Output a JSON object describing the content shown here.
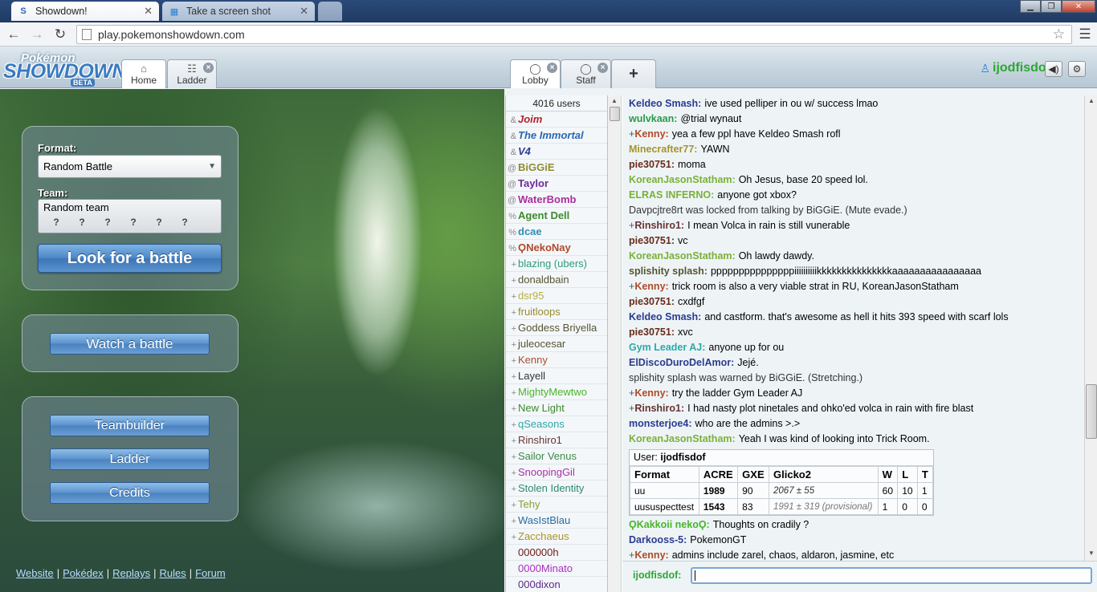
{
  "browser": {
    "tabs": [
      {
        "title": "Showdown!",
        "active": true
      },
      {
        "title": "Take a screen shot",
        "active": false
      }
    ],
    "url": "play.pokemonshowdown.com"
  },
  "header": {
    "logo": {
      "line1": "Pokémon",
      "line2": "SHOWDOWN",
      "badge": "BETA"
    },
    "left_tabs": [
      {
        "label": "Home",
        "icon": "home-icon"
      },
      {
        "label": "Ladder",
        "icon": "list-icon"
      }
    ],
    "room_tabs": [
      {
        "label": "Lobby",
        "icon": "chat-bubble-icon"
      },
      {
        "label": "Staff",
        "icon": "chat-bubble-icon"
      }
    ],
    "add_tab": "+",
    "username": "ijodfisdof"
  },
  "home": {
    "format_label": "Format:",
    "format_value": "Random Battle",
    "team_label": "Team:",
    "team_value": "Random team",
    "look_button": "Look for a battle",
    "watch_button": "Watch a battle",
    "teambuilder_button": "Teambuilder",
    "ladder_button": "Ladder",
    "credits_button": "Credits",
    "links": [
      "Website",
      "Pokédex",
      "Replays",
      "Rules",
      "Forum"
    ]
  },
  "userlist": {
    "count": "4016 users",
    "users": [
      {
        "group": "&",
        "name": "Joim",
        "color": "#b3232a",
        "style": "bi"
      },
      {
        "group": "&",
        "name": "The Immortal",
        "color": "#2a67b0",
        "style": "bi"
      },
      {
        "group": "&",
        "name": "V4",
        "color": "#2b3b8f",
        "style": "bi"
      },
      {
        "group": "@",
        "name": "BiGGiE",
        "color": "#8d8d30",
        "style": "b"
      },
      {
        "group": "@",
        "name": "Taylor",
        "color": "#6a2b9a",
        "style": "b"
      },
      {
        "group": "@",
        "name": "WaterBomb",
        "color": "#a8309b",
        "style": "b"
      },
      {
        "group": "%",
        "name": "Agent Dell",
        "color": "#3c8c2c",
        "style": "b"
      },
      {
        "group": "%",
        "name": "dcae",
        "color": "#2e8fb5",
        "style": "b"
      },
      {
        "group": "%",
        "name": "ϘNekoNay",
        "color": "#b04a2a",
        "style": "b"
      },
      {
        "group": "+",
        "name": "blazing (ubers)",
        "color": "#2e9a7a",
        "style": ""
      },
      {
        "group": "+",
        "name": "donaldbain",
        "color": "#555533",
        "style": ""
      },
      {
        "group": "+",
        "name": "dsr95",
        "color": "#b3b044",
        "style": ""
      },
      {
        "group": "+",
        "name": "fruitloops",
        "color": "#9a8a30",
        "style": ""
      },
      {
        "group": "+",
        "name": "Goddess Briyella",
        "color": "#555533",
        "style": ""
      },
      {
        "group": "+",
        "name": "juleocesar",
        "color": "#555533",
        "style": ""
      },
      {
        "group": "+",
        "name": "Kenny",
        "color": "#b04a2a",
        "style": ""
      },
      {
        "group": "+",
        "name": "Layell",
        "color": "#333333",
        "style": ""
      },
      {
        "group": "+",
        "name": "MightyMewtwo",
        "color": "#49b52c",
        "style": ""
      },
      {
        "group": "+",
        "name": "New Light",
        "color": "#3a8a30",
        "style": ""
      },
      {
        "group": "+",
        "name": "qSeasons",
        "color": "#2ea8a8",
        "style": ""
      },
      {
        "group": "+",
        "name": "Rinshiro1",
        "color": "#663333",
        "style": ""
      },
      {
        "group": "+",
        "name": "Sailor Venus",
        "color": "#3a8a4a",
        "style": ""
      },
      {
        "group": "+",
        "name": "SnoopingGil",
        "color": "#a830a8",
        "style": ""
      },
      {
        "group": "+",
        "name": "Stolen Identity",
        "color": "#2e8a6a",
        "style": ""
      },
      {
        "group": "+",
        "name": "Tehy",
        "color": "#88a030",
        "style": ""
      },
      {
        "group": "+",
        "name": "WasIstBlau",
        "color": "#2a6aa0",
        "style": ""
      },
      {
        "group": "+",
        "name": "Zacchaeus",
        "color": "#a8942a",
        "style": ""
      },
      {
        "group": "",
        "name": "000000h",
        "color": "#6a1a1a",
        "style": ""
      },
      {
        "group": "",
        "name": "0000Minato",
        "color": "#a830c0",
        "style": ""
      },
      {
        "group": "",
        "name": "000dixon",
        "color": "#5a2a8a",
        "style": ""
      }
    ]
  },
  "chat": {
    "messages": [
      {
        "rank": "",
        "author": "Keldeo Smash:",
        "color": "#2b3b8f",
        "text": "ive used pelliper in ou w/ success lmao"
      },
      {
        "rank": "",
        "author": "wulvkaan:",
        "color": "#2a9a4a",
        "text": "@trial wynaut"
      },
      {
        "rank": "+",
        "author": "Kenny:",
        "color": "#b04a2a",
        "text": "yea a few ppl have Keldeo Smash rofl"
      },
      {
        "rank": "",
        "author": "Minecrafter77:",
        "color": "#a8942a",
        "text": "YAWN"
      },
      {
        "rank": "",
        "author": "pie30751:",
        "color": "#6a2a1a",
        "text": "moma"
      },
      {
        "rank": "",
        "author": "KoreanJasonStatham:",
        "color": "#7ab03a",
        "text": "Oh Jesus, base 20 speed lol."
      },
      {
        "rank": "",
        "author": "ELRAS INFERNO:",
        "color": "#7ab03a",
        "text": "anyone got xbox?"
      },
      {
        "rank": "",
        "author": "",
        "color": "#333333",
        "text": "Davpcjtre8rt was locked from talking by BiGGiE. (Mute evade.)"
      },
      {
        "rank": "+",
        "author": "Rinshiro1:",
        "color": "#663333",
        "text": "I mean Volca in rain is still vunerable"
      },
      {
        "rank": "",
        "author": "pie30751:",
        "color": "#6a2a1a",
        "text": "vc"
      },
      {
        "rank": "",
        "author": "KoreanJasonStatham:",
        "color": "#7ab03a",
        "text": "Oh lawdy dawdy."
      },
      {
        "rank": "",
        "author": "splishity splash:",
        "color": "#555533",
        "text": "pppppppppppppppiiiiiiiiiikkkkkkkkkkkkkkkaaaaaaaaaaaaaaaa"
      },
      {
        "rank": "+",
        "author": "Kenny:",
        "color": "#b04a2a",
        "text": "trick room is also a very viable strat in RU, KoreanJasonStatham"
      },
      {
        "rank": "",
        "author": "pie30751:",
        "color": "#6a2a1a",
        "text": "cxdfgf"
      },
      {
        "rank": "",
        "author": "Keldeo Smash:",
        "color": "#2b3b8f",
        "text": "and castform. that's awesome as hell it hits 393 speed with scarf lols"
      },
      {
        "rank": "",
        "author": "pie30751:",
        "color": "#6a2a1a",
        "text": "xvc"
      },
      {
        "rank": "",
        "author": "Gym Leader AJ:",
        "color": "#2ea8a8",
        "text": "anyone up for ou"
      },
      {
        "rank": "",
        "author": "ElDiscoDuroDelAmor:",
        "color": "#2b3b8f",
        "text": "Jejé."
      },
      {
        "rank": "",
        "author": "",
        "color": "#333333",
        "text": "splishity splash was warned by BiGGiE. (Stretching.)"
      },
      {
        "rank": "+",
        "author": "Kenny:",
        "color": "#b04a2a",
        "text": "try the ladder Gym Leader AJ"
      },
      {
        "rank": "+",
        "author": "Rinshiro1:",
        "color": "#663333",
        "text": "I had nasty plot ninetales and ohko'ed volca in rain with fire blast"
      },
      {
        "rank": "",
        "author": "monsterjoe4:",
        "color": "#2b3b8f",
        "text": "who are the admins >.>"
      },
      {
        "rank": "",
        "author": "KoreanJasonStatham:",
        "color": "#7ab03a",
        "text": "Yeah I was kind of looking into Trick Room."
      }
    ],
    "rating": {
      "user_label": "User:",
      "user": "ijodfisdof",
      "columns": [
        "Format",
        "ACRE",
        "GXE",
        "Glicko2",
        "W",
        "L",
        "T"
      ],
      "rows": [
        {
          "format": "uu",
          "acre": "1989",
          "gxe": "90",
          "glicko": "2067 ± 55",
          "w": "60",
          "l": "10",
          "t": "1"
        },
        {
          "format": "uususpecttest",
          "acre": "1543",
          "gxe": "83",
          "glicko": "1991 ± 319 (provisional)",
          "w": "1",
          "l": "0",
          "t": "0"
        }
      ]
    },
    "after": [
      {
        "rank": "",
        "author": "ϘKakkoii nekoϘ:",
        "color": "#49b52c",
        "text": "Thoughts on cradily ?"
      },
      {
        "rank": "",
        "author": "Darkooss-5:",
        "color": "#2b3b8f",
        "text": "PokemonGT"
      },
      {
        "rank": "+",
        "author": "Kenny:",
        "color": "#b04a2a",
        "text": "admins include zarel, chaos, aldaron, jasmine, etc"
      }
    ],
    "input_user": "ijodfisdof:",
    "input_value": ""
  }
}
